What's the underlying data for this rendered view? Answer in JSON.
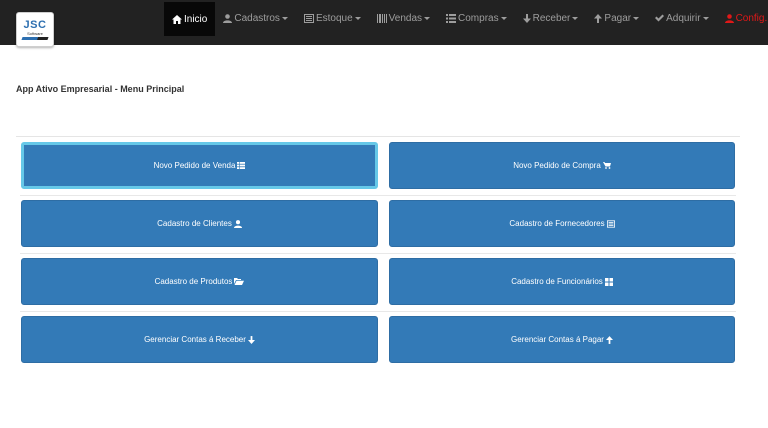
{
  "logo": {
    "top": "JSC",
    "bottom": "Software"
  },
  "nav": [
    {
      "label": "Inicio",
      "icon": "home-icon",
      "active": true
    },
    {
      "label": "Cadastros",
      "icon": "user-icon",
      "dropdown": true
    },
    {
      "label": "Estoque",
      "icon": "list-alt-icon",
      "dropdown": true
    },
    {
      "label": "Vendas",
      "icon": "barcode-icon",
      "dropdown": true
    },
    {
      "label": "Compras",
      "icon": "list-icon",
      "dropdown": true
    },
    {
      "label": "Receber",
      "icon": "arrow-down-icon",
      "dropdown": true
    },
    {
      "label": "Pagar",
      "icon": "arrow-up-icon",
      "dropdown": true
    },
    {
      "label": "Adquirir",
      "icon": "check-icon",
      "dropdown": true
    },
    {
      "label": "Config.",
      "icon": "user-icon",
      "dropdown": true,
      "color": "#e01818"
    }
  ],
  "page_title": "App Ativo Empresarial - Menu Principal",
  "buttons": [
    {
      "label": "Novo Pedido de Venda",
      "icon": "th-list-icon"
    },
    {
      "label": "Novo Pedido de Compra",
      "icon": "shopping-cart-icon"
    },
    {
      "label": "Cadastro de Clientes",
      "icon": "user-icon"
    },
    {
      "label": "Cadastro de Fornecedores",
      "icon": "list-alt-icon"
    },
    {
      "label": "Cadastro de Produtos",
      "icon": "folder-open-icon"
    },
    {
      "label": "Cadastro de Funcionários",
      "icon": "th-large-icon"
    },
    {
      "label": "Gerenciar Contas á Receber",
      "icon": "arrow-down-icon"
    },
    {
      "label": "Gerenciar Contas á Pagar",
      "icon": "arrow-up-icon"
    }
  ],
  "colors": {
    "navbar": "#222222",
    "button": "#337ab7",
    "focus": "#66c8e8",
    "config": "#e01818"
  }
}
